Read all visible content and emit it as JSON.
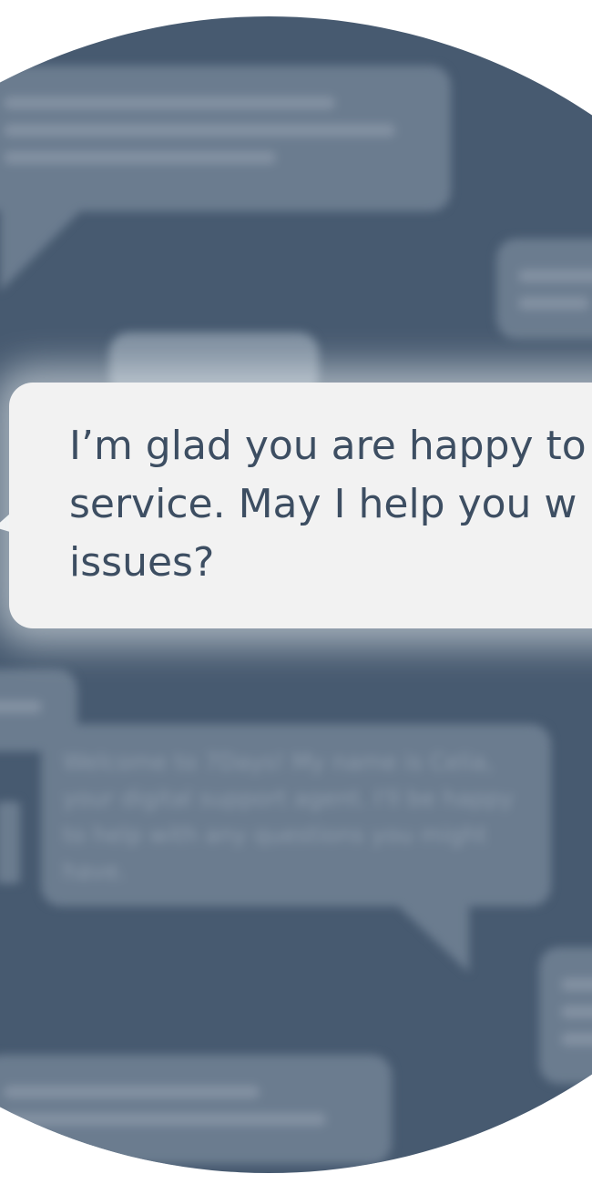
{
  "foreground_message": {
    "lines": [
      "I’m glad you are happy to",
      "service. May I help you w",
      "issues?"
    ]
  },
  "background_messages": [
    {
      "id": "top-left",
      "text": "",
      "line_count": 3
    },
    {
      "id": "right-upper",
      "text": "",
      "line_count": 2
    },
    {
      "id": "welcome",
      "text": "Welcome to 7Days! My name is Celia, your digital support agent. I'll be happy to help with any questions you might have.",
      "line_count": 4
    },
    {
      "id": "right-lower",
      "text": "",
      "line_count": 3
    },
    {
      "id": "bottom-left",
      "text": "",
      "line_count": 2
    }
  ],
  "colors": {
    "circle_background": "#475a70",
    "blurred_bubble": "#6b7c8f",
    "foreground_bubble": "#f2f2f2",
    "foreground_text": "#3d4e62",
    "page_background": "#ffffff"
  }
}
